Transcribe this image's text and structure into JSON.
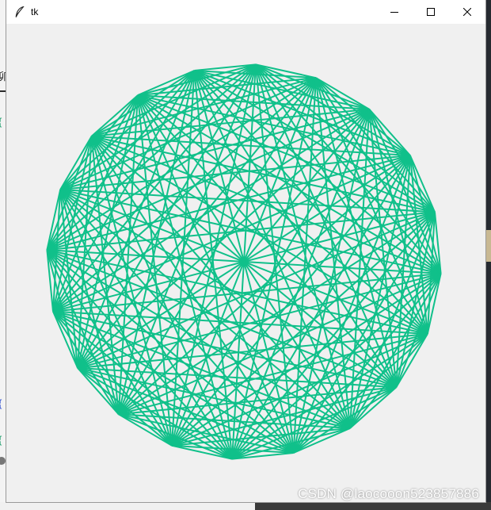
{
  "window": {
    "title": "tk",
    "app_icon": "feather-icon",
    "controls": [
      "minimize-icon",
      "maximize-icon",
      "close-icon"
    ]
  },
  "figure": {
    "shape": "complete-graph-polygon",
    "vertex_count": 20,
    "line_color": "#10c08a",
    "background": "#f0f0f0"
  },
  "background_app": {
    "chars": [
      "卯",
      "{",
      "{",
      "{"
    ]
  },
  "watermark": "CSDN @laocooon523857886"
}
